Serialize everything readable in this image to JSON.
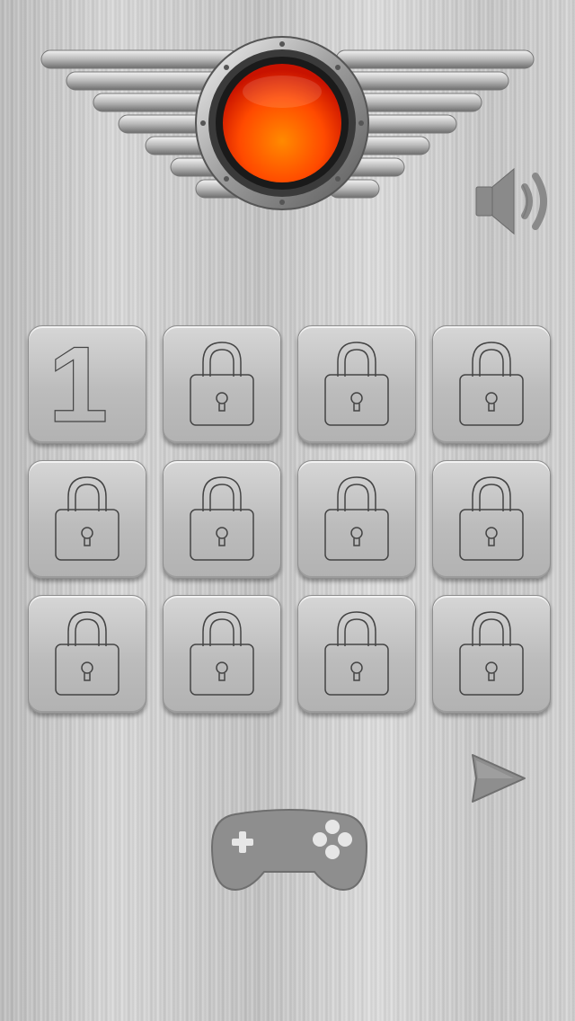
{
  "header": {
    "emblem_icon": "winged-red-button-emblem",
    "emblem_color": "#ff5a00"
  },
  "controls": {
    "sound_icon": "speaker-volume-icon",
    "next_icon": "arrow-right-icon",
    "gamepad_icon": "gamepad-icon"
  },
  "levels": [
    {
      "label": "1",
      "locked": false
    },
    {
      "label": "",
      "locked": true
    },
    {
      "label": "",
      "locked": true
    },
    {
      "label": "",
      "locked": true
    },
    {
      "label": "",
      "locked": true
    },
    {
      "label": "",
      "locked": true
    },
    {
      "label": "",
      "locked": true
    },
    {
      "label": "",
      "locked": true
    },
    {
      "label": "",
      "locked": true
    },
    {
      "label": "",
      "locked": true
    },
    {
      "label": "",
      "locked": true
    },
    {
      "label": "",
      "locked": true
    }
  ],
  "colors": {
    "tile_stroke": "#444444",
    "icon_gray": "#8a8a8a"
  }
}
